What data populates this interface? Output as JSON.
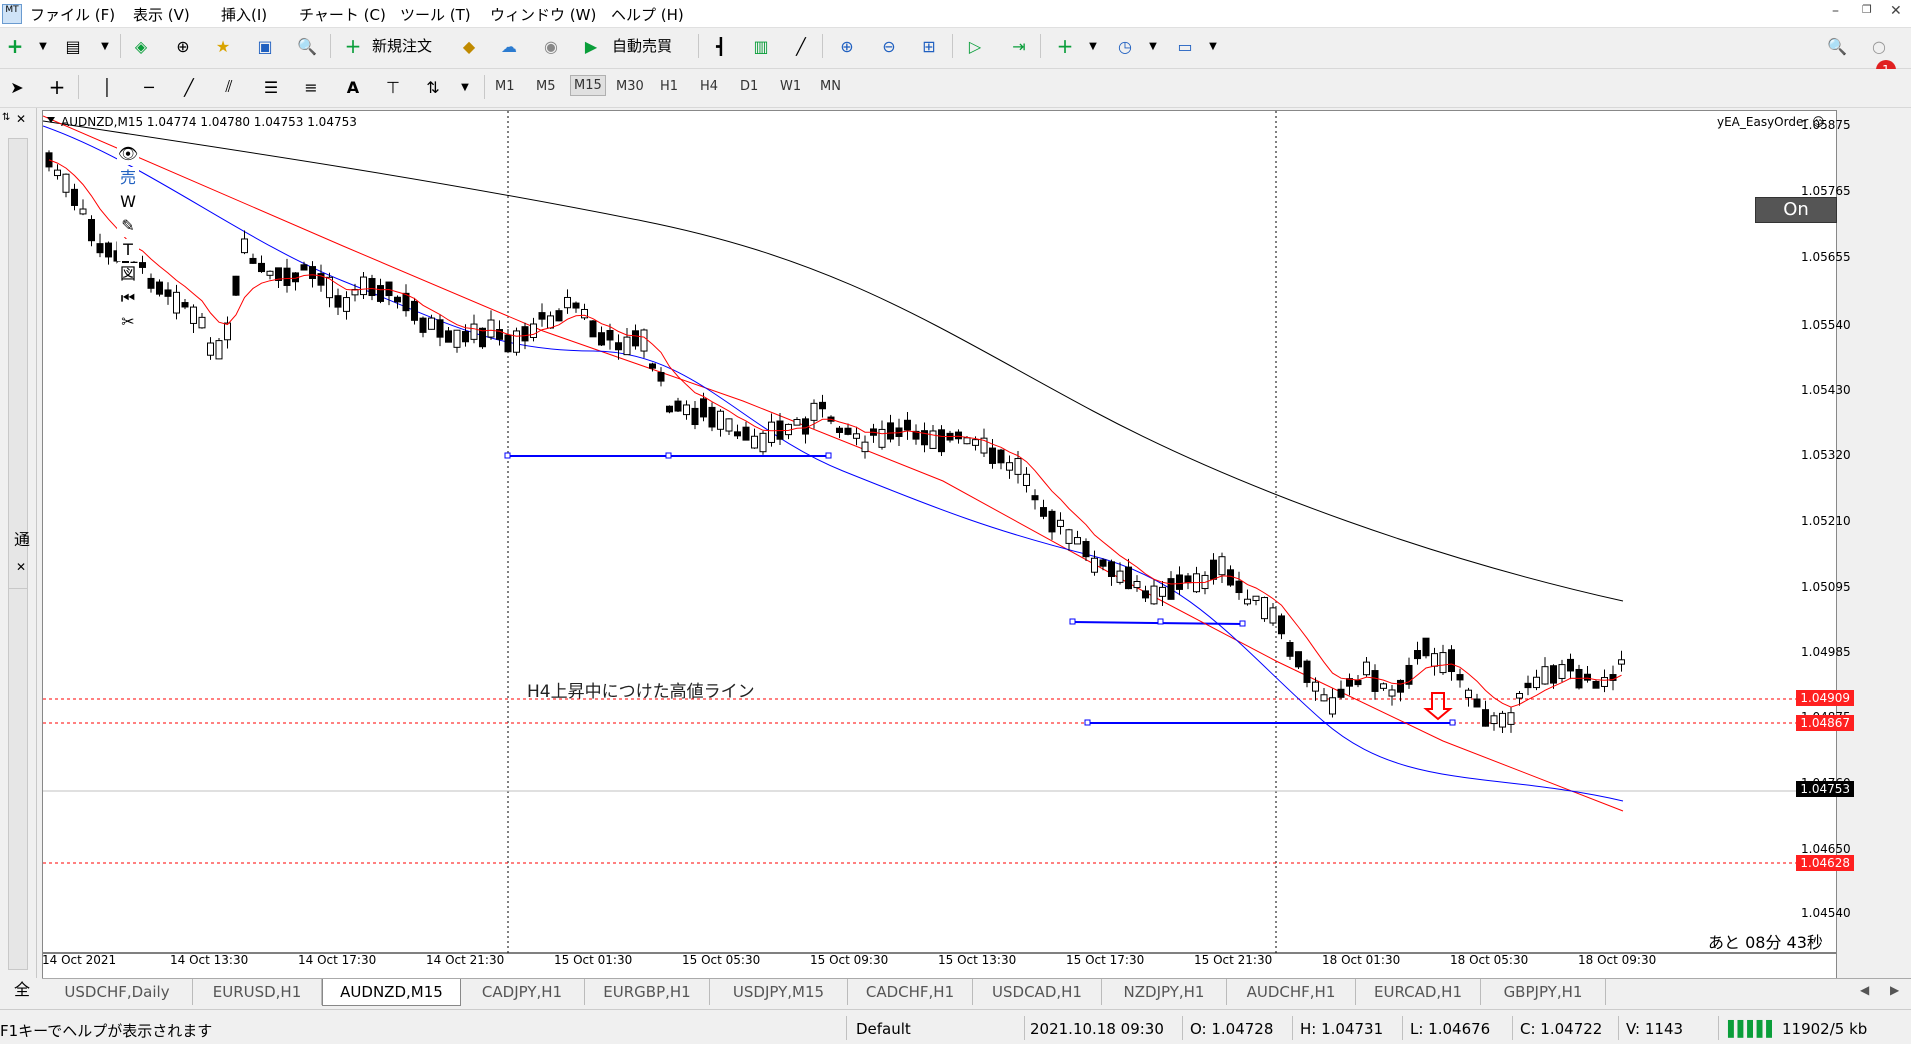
{
  "menu": [
    "ファイル (F)",
    "表示 (V)",
    "挿入(I)",
    "チャート (C)",
    "ツール (T)",
    "ウィンドウ (W)",
    "ヘルプ (H)"
  ],
  "toolbar": {
    "new_order": "新規注文",
    "auto_trade": "自動売買",
    "notification_count": "1"
  },
  "timeframes": [
    "M1",
    "M5",
    "M15",
    "M30",
    "H1",
    "H4",
    "D1",
    "W1",
    "MN"
  ],
  "active_timeframe": "M15",
  "chart": {
    "header": "AUDNZD,M15  1.04774 1.04780 1.04753 1.04753",
    "ea_name": "yEA_EasyOrder ☺",
    "on_button": "On",
    "annotation": "H4上昇中につけた高値ライン",
    "countdown": "あと 08分 43秒",
    "price_labels": [
      "1.05875",
      "1.05765",
      "1.05655",
      "1.05540",
      "1.05430",
      "1.05320",
      "1.05210",
      "1.05095",
      "1.04985",
      "1.04875",
      "1.04760",
      "1.04650",
      "1.04540"
    ],
    "tag_prices": {
      "line1": "1.04909",
      "line2": "1.04867",
      "current": "1.04753",
      "line3": "1.04628"
    },
    "time_labels": [
      "14 Oct 2021",
      "14 Oct 13:30",
      "14 Oct 17:30",
      "14 Oct 21:30",
      "15 Oct 01:30",
      "15 Oct 05:30",
      "15 Oct 09:30",
      "15 Oct 13:30",
      "15 Oct 17:30",
      "15 Oct 21:30",
      "18 Oct 01:30",
      "18 Oct 05:30",
      "18 Oct 09:30"
    ],
    "colors": {
      "sma_fast": "#ff0000",
      "sma_mid": "#0000ff",
      "sma_slow": "#000000",
      "hline": "#ff0000",
      "trendbox": "#0000ff"
    }
  },
  "side_tools": [
    "👁",
    "売",
    "W",
    "✎",
    "T",
    "図",
    "⏮",
    "✂"
  ],
  "left_strip": {
    "top_label": "通",
    "bottom_label": "全"
  },
  "tabs": [
    "USDCHF,Daily",
    "EURUSD,H1",
    "AUDNZD,M15",
    "CADJPY,H1",
    "EURGBP,H1",
    "USDJPY,M15",
    "CADCHF,H1",
    "USDCAD,H1",
    "NZDJPY,H1",
    "AUDCHF,H1",
    "EURCAD,H1",
    "GBPJPY,H1"
  ],
  "active_tab": "AUDNZD,M15",
  "status": {
    "help": "F1キーでヘルプが表示されます",
    "profile": "Default",
    "datetime": "2021.10.18 09:30",
    "open": "O: 1.04728",
    "high": "H: 1.04731",
    "low": "L: 1.04676",
    "close": "C: 1.04722",
    "volume": "V: 1143",
    "traffic": "11902/5 kb"
  }
}
